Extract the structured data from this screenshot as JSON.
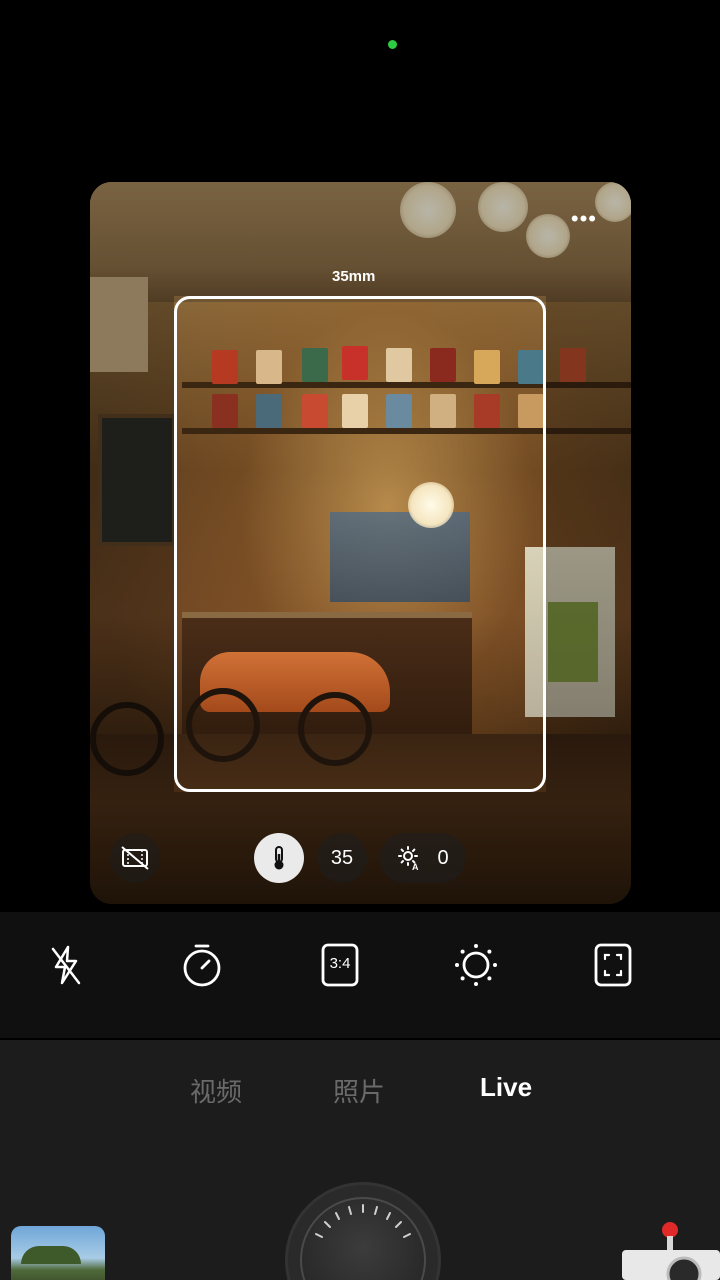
{
  "viewfinder": {
    "focal_length_label": "35mm",
    "zoom_value": "35",
    "exposure_value": "0"
  },
  "toolbar": {
    "tools": [
      "flash-off",
      "timer",
      "aspect-ratio",
      "brightness",
      "focus-frame"
    ],
    "aspect_ratio_label": "3:4"
  },
  "modes": {
    "video": "视频",
    "photo": "照片",
    "live": "Live",
    "active": "live"
  },
  "colors": {
    "status_indicator": "#2ecc40",
    "shutter_accent": "#e02a2a"
  }
}
